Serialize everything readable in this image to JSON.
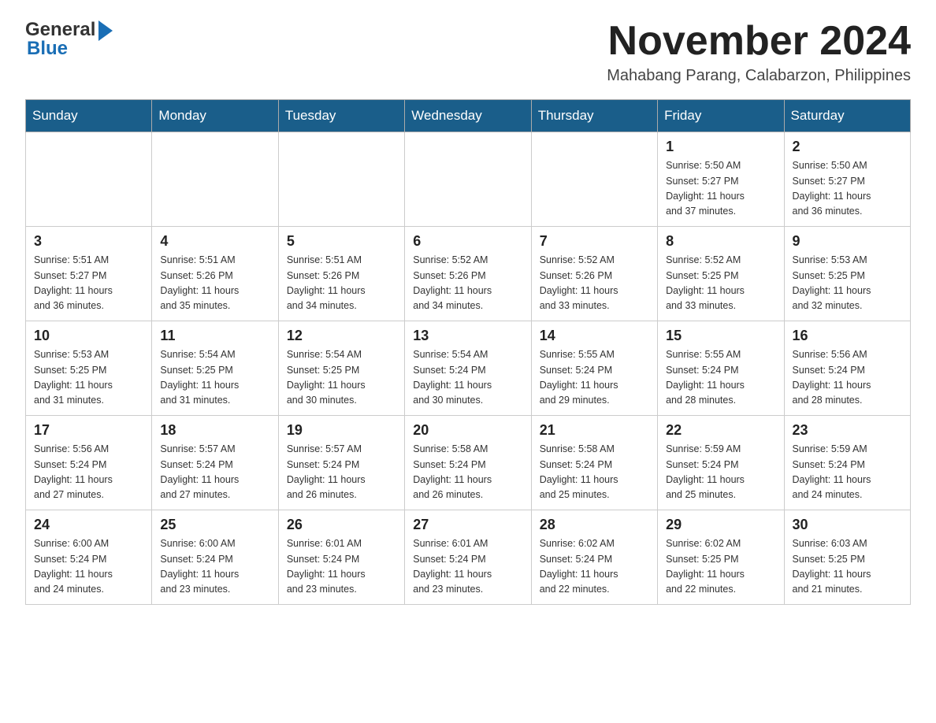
{
  "header": {
    "logo_general": "General",
    "logo_blue": "Blue",
    "month_title": "November 2024",
    "subtitle": "Mahabang Parang, Calabarzon, Philippines"
  },
  "days_of_week": [
    "Sunday",
    "Monday",
    "Tuesday",
    "Wednesday",
    "Thursday",
    "Friday",
    "Saturday"
  ],
  "weeks": [
    {
      "days": [
        {
          "number": "",
          "info": ""
        },
        {
          "number": "",
          "info": ""
        },
        {
          "number": "",
          "info": ""
        },
        {
          "number": "",
          "info": ""
        },
        {
          "number": "",
          "info": ""
        },
        {
          "number": "1",
          "info": "Sunrise: 5:50 AM\nSunset: 5:27 PM\nDaylight: 11 hours\nand 37 minutes."
        },
        {
          "number": "2",
          "info": "Sunrise: 5:50 AM\nSunset: 5:27 PM\nDaylight: 11 hours\nand 36 minutes."
        }
      ]
    },
    {
      "days": [
        {
          "number": "3",
          "info": "Sunrise: 5:51 AM\nSunset: 5:27 PM\nDaylight: 11 hours\nand 36 minutes."
        },
        {
          "number": "4",
          "info": "Sunrise: 5:51 AM\nSunset: 5:26 PM\nDaylight: 11 hours\nand 35 minutes."
        },
        {
          "number": "5",
          "info": "Sunrise: 5:51 AM\nSunset: 5:26 PM\nDaylight: 11 hours\nand 34 minutes."
        },
        {
          "number": "6",
          "info": "Sunrise: 5:52 AM\nSunset: 5:26 PM\nDaylight: 11 hours\nand 34 minutes."
        },
        {
          "number": "7",
          "info": "Sunrise: 5:52 AM\nSunset: 5:26 PM\nDaylight: 11 hours\nand 33 minutes."
        },
        {
          "number": "8",
          "info": "Sunrise: 5:52 AM\nSunset: 5:25 PM\nDaylight: 11 hours\nand 33 minutes."
        },
        {
          "number": "9",
          "info": "Sunrise: 5:53 AM\nSunset: 5:25 PM\nDaylight: 11 hours\nand 32 minutes."
        }
      ]
    },
    {
      "days": [
        {
          "number": "10",
          "info": "Sunrise: 5:53 AM\nSunset: 5:25 PM\nDaylight: 11 hours\nand 31 minutes."
        },
        {
          "number": "11",
          "info": "Sunrise: 5:54 AM\nSunset: 5:25 PM\nDaylight: 11 hours\nand 31 minutes."
        },
        {
          "number": "12",
          "info": "Sunrise: 5:54 AM\nSunset: 5:25 PM\nDaylight: 11 hours\nand 30 minutes."
        },
        {
          "number": "13",
          "info": "Sunrise: 5:54 AM\nSunset: 5:24 PM\nDaylight: 11 hours\nand 30 minutes."
        },
        {
          "number": "14",
          "info": "Sunrise: 5:55 AM\nSunset: 5:24 PM\nDaylight: 11 hours\nand 29 minutes."
        },
        {
          "number": "15",
          "info": "Sunrise: 5:55 AM\nSunset: 5:24 PM\nDaylight: 11 hours\nand 28 minutes."
        },
        {
          "number": "16",
          "info": "Sunrise: 5:56 AM\nSunset: 5:24 PM\nDaylight: 11 hours\nand 28 minutes."
        }
      ]
    },
    {
      "days": [
        {
          "number": "17",
          "info": "Sunrise: 5:56 AM\nSunset: 5:24 PM\nDaylight: 11 hours\nand 27 minutes."
        },
        {
          "number": "18",
          "info": "Sunrise: 5:57 AM\nSunset: 5:24 PM\nDaylight: 11 hours\nand 27 minutes."
        },
        {
          "number": "19",
          "info": "Sunrise: 5:57 AM\nSunset: 5:24 PM\nDaylight: 11 hours\nand 26 minutes."
        },
        {
          "number": "20",
          "info": "Sunrise: 5:58 AM\nSunset: 5:24 PM\nDaylight: 11 hours\nand 26 minutes."
        },
        {
          "number": "21",
          "info": "Sunrise: 5:58 AM\nSunset: 5:24 PM\nDaylight: 11 hours\nand 25 minutes."
        },
        {
          "number": "22",
          "info": "Sunrise: 5:59 AM\nSunset: 5:24 PM\nDaylight: 11 hours\nand 25 minutes."
        },
        {
          "number": "23",
          "info": "Sunrise: 5:59 AM\nSunset: 5:24 PM\nDaylight: 11 hours\nand 24 minutes."
        }
      ]
    },
    {
      "days": [
        {
          "number": "24",
          "info": "Sunrise: 6:00 AM\nSunset: 5:24 PM\nDaylight: 11 hours\nand 24 minutes."
        },
        {
          "number": "25",
          "info": "Sunrise: 6:00 AM\nSunset: 5:24 PM\nDaylight: 11 hours\nand 23 minutes."
        },
        {
          "number": "26",
          "info": "Sunrise: 6:01 AM\nSunset: 5:24 PM\nDaylight: 11 hours\nand 23 minutes."
        },
        {
          "number": "27",
          "info": "Sunrise: 6:01 AM\nSunset: 5:24 PM\nDaylight: 11 hours\nand 23 minutes."
        },
        {
          "number": "28",
          "info": "Sunrise: 6:02 AM\nSunset: 5:24 PM\nDaylight: 11 hours\nand 22 minutes."
        },
        {
          "number": "29",
          "info": "Sunrise: 6:02 AM\nSunset: 5:25 PM\nDaylight: 11 hours\nand 22 minutes."
        },
        {
          "number": "30",
          "info": "Sunrise: 6:03 AM\nSunset: 5:25 PM\nDaylight: 11 hours\nand 21 minutes."
        }
      ]
    }
  ]
}
